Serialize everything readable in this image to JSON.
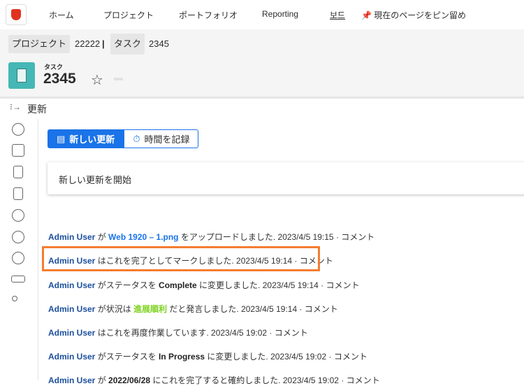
{
  "nav": {
    "items": [
      "ホーム",
      "プロジェクト",
      "ポートフォリオ",
      "Reporting",
      "보드"
    ],
    "pin": "現在のページをピン留め"
  },
  "breadcrumb": {
    "project_label": "プロジェクト",
    "project_value": "22222",
    "sep": "|",
    "task_label": "タスク",
    "task_value": "2345"
  },
  "header": {
    "type": "タスク",
    "title": "2345",
    "more": "○○○"
  },
  "section": {
    "title": "更新"
  },
  "buttons": {
    "new_update": "新しい更新",
    "log_time": "時間を記録"
  },
  "new_update_placeholder": "新しい更新を開始",
  "updates": [
    {
      "user": "Admin User",
      "pre": " が ",
      "link": "Web 1920 – 1.png",
      "post": " をアップロードしました. ",
      "time": "2023/4/5 19:15",
      "comment": " · コメント"
    },
    {
      "user": "Admin User",
      "pre": " はこれを完了としてマークしました. ",
      "time": "2023/4/5 19:14",
      "comment": " · コメント"
    },
    {
      "user": "Admin User",
      "pre": " がステータスを ",
      "bold": "Complete",
      "post": " に変更しました. ",
      "time": "2023/4/5 19:14",
      "comment": " · コメント"
    },
    {
      "user": "Admin User",
      "pre": " が状況は ",
      "green": "進展順利",
      "post": " だと発言しました. ",
      "time": "2023/4/5 19:14",
      "comment": " · コメント"
    },
    {
      "user": "Admin User",
      "pre": " はこれを再度作業しています. ",
      "time": "2023/4/5 19:02",
      "comment": " · コメント"
    },
    {
      "user": "Admin User",
      "pre": " がステータスを ",
      "bold": "In Progress",
      "post": " に変更しました. ",
      "time": "2023/4/5 19:02",
      "comment": " · コメント"
    },
    {
      "user": "Admin User",
      "pre": " が ",
      "bold": "2022/06/28",
      "post": " にこれを完了すると確約しました. ",
      "time": "2023/4/5 19:02",
      "comment": " · コメント"
    }
  ],
  "colors": {
    "primary": "#1a73e8",
    "highlight": "#f47d31",
    "task_icon": "#45b7b4"
  }
}
